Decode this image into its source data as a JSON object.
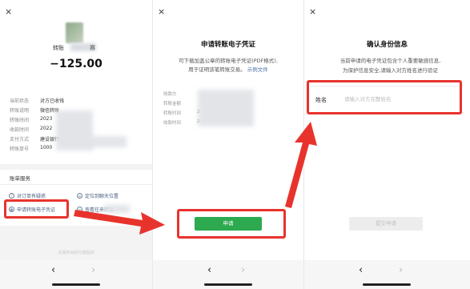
{
  "panel1": {
    "close_glyph": "×",
    "recipient_name": "转账",
    "recipient_name_suffix": "赛",
    "amount": "−125.00",
    "details": [
      {
        "key": "当前状态",
        "value": "对方已收钱"
      },
      {
        "key": "转账说明",
        "value": "微信转账"
      },
      {
        "key": "转账时间",
        "value": "2023"
      },
      {
        "key": "收款时间",
        "value": "2022"
      },
      {
        "key": "支付方式",
        "value": "建设银行储蓄卡"
      },
      {
        "key": "转账单号",
        "value": "1000"
      }
    ],
    "service_title": "账单服务",
    "services": [
      {
        "label": "对订单有疑惑",
        "icon": "question-icon"
      },
      {
        "label": "定位到聊天位置",
        "icon": "locate-icon"
      },
      {
        "label": "申请转账电子凭证",
        "icon": "certificate-icon"
      },
      {
        "label": "查看往来转账",
        "icon": "list-icon"
      }
    ],
    "footer_note": "本服务由财付通提供"
  },
  "panel2": {
    "close_glyph": "×",
    "title": "申请转账电子凭证",
    "desc_line1": "可下载加盖公章的转账电子凭证(PDF格式),",
    "desc_line2": "用于证明该笔转账交易。",
    "desc_link": "示例文件",
    "rows": [
      {
        "key": "收款方",
        "value": ""
      },
      {
        "key": "转账金额",
        "value": ""
      },
      {
        "key": "转账时间",
        "value": "2"
      },
      {
        "key": "收款时间",
        "value": "2"
      }
    ],
    "apply_label": "申请"
  },
  "panel3": {
    "close_glyph": "×",
    "title": "确认身份信息",
    "desc_line1": "当前申请的电子凭证包含个人重要敏感信息,",
    "desc_line2": "为保护信息安全,请输入对方姓名进行验证",
    "name_label": "姓名",
    "name_placeholder": "请输入对方完整姓名",
    "submit_label": "提交申请"
  },
  "nav": {
    "back": "‹",
    "forward": "›"
  },
  "colors": {
    "highlight": "#e8332d",
    "primary_green": "#2da94f",
    "link_blue": "#4a6fa5"
  }
}
